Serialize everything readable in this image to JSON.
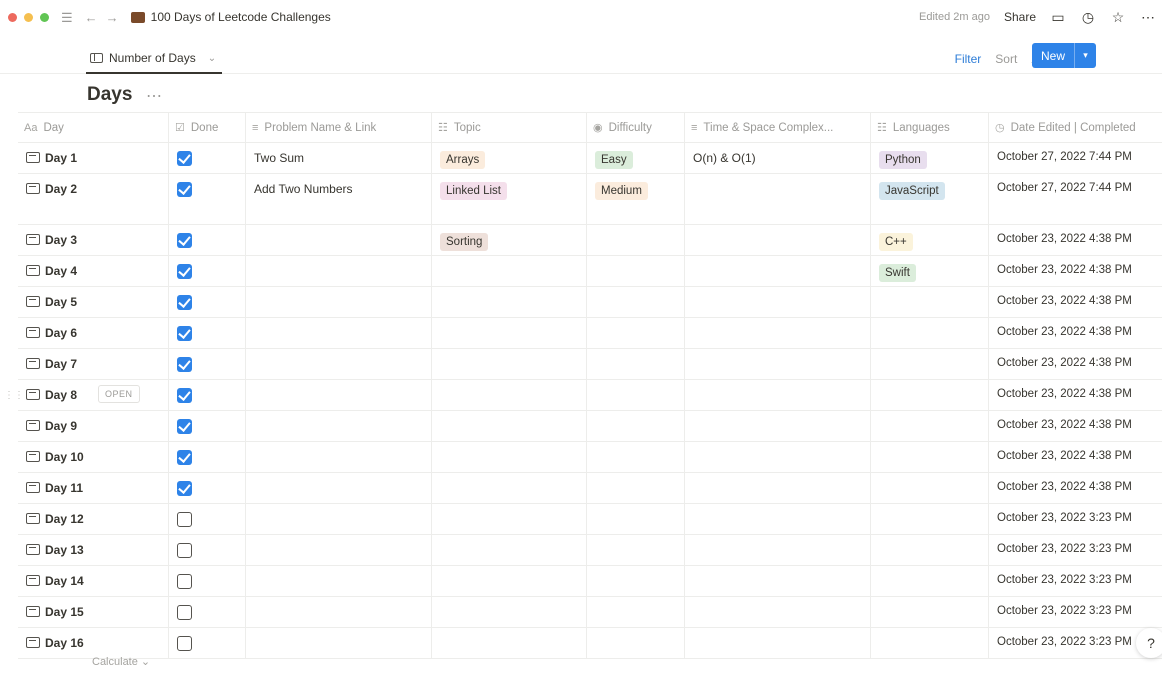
{
  "topbar": {
    "page_title": "100 Days of Leetcode Challenges",
    "edited": "Edited 2m ago",
    "share": "Share"
  },
  "view": {
    "tab_label": "Number of Days",
    "filter": "Filter",
    "sort": "Sort",
    "new_label": "New"
  },
  "database": {
    "title": "Days"
  },
  "columns": [
    {
      "label": "Day",
      "icon": "Aa"
    },
    {
      "label": "Done",
      "icon": "checkbox-icon"
    },
    {
      "label": "Problem Name & Link",
      "icon": "text-icon"
    },
    {
      "label": "Topic",
      "icon": "multi-select-icon"
    },
    {
      "label": "Difficulty",
      "icon": "select-icon"
    },
    {
      "label": "Time & Space Complex...",
      "icon": "text-icon"
    },
    {
      "label": "Languages",
      "icon": "multi-select-icon"
    },
    {
      "label": "Date Edited | Completed",
      "icon": "clock-icon"
    }
  ],
  "rows": [
    {
      "day": "Day 1",
      "done": true,
      "problem": "Two Sum",
      "topic": "Arrays",
      "topic_color": "#fbecdd",
      "difficulty": "Easy",
      "difficulty_color": "#dbeddb",
      "complexity": "O(n) & O(1)",
      "language": "Python",
      "language_color": "#e8deee",
      "date": "October 27, 2022 7:44 PM"
    },
    {
      "day": "Day 2",
      "done": true,
      "problem": "Add Two Numbers",
      "topic": "Linked List",
      "topic_color": "#f4dfeb",
      "difficulty": "Medium",
      "difficulty_color": "#fbecdd",
      "complexity": "",
      "language": "JavaScript",
      "language_color": "#d3e5ef",
      "date": "October 27, 2022 7:44 PM"
    },
    {
      "day": "Day 3",
      "done": true,
      "problem": "",
      "topic": "Sorting",
      "topic_color": "#eee0da",
      "difficulty": "",
      "difficulty_color": "",
      "complexity": "",
      "language": "C++",
      "language_color": "#fbf3db",
      "date": "October 23, 2022 4:38 PM"
    },
    {
      "day": "Day 4",
      "done": true,
      "problem": "",
      "topic": "",
      "topic_color": "",
      "difficulty": "",
      "difficulty_color": "",
      "complexity": "",
      "language": "Swift",
      "language_color": "#dbeddb",
      "date": "October 23, 2022 4:38 PM"
    },
    {
      "day": "Day 5",
      "done": true,
      "problem": "",
      "topic": "",
      "topic_color": "",
      "difficulty": "",
      "difficulty_color": "",
      "complexity": "",
      "language": "",
      "language_color": "",
      "date": "October 23, 2022 4:38 PM"
    },
    {
      "day": "Day 6",
      "done": true,
      "problem": "",
      "topic": "",
      "topic_color": "",
      "difficulty": "",
      "difficulty_color": "",
      "complexity": "",
      "language": "",
      "language_color": "",
      "date": "October 23, 2022 4:38 PM"
    },
    {
      "day": "Day 7",
      "done": true,
      "problem": "",
      "topic": "",
      "topic_color": "",
      "difficulty": "",
      "difficulty_color": "",
      "complexity": "",
      "language": "",
      "language_color": "",
      "date": "October 23, 2022 4:38 PM"
    },
    {
      "day": "Day 8",
      "done": true,
      "problem": "",
      "topic": "",
      "topic_color": "",
      "difficulty": "",
      "difficulty_color": "",
      "complexity": "",
      "language": "",
      "language_color": "",
      "date": "October 23, 2022 4:38 PM",
      "open": "OPEN"
    },
    {
      "day": "Day 9",
      "done": true,
      "problem": "",
      "topic": "",
      "topic_color": "",
      "difficulty": "",
      "difficulty_color": "",
      "complexity": "",
      "language": "",
      "language_color": "",
      "date": "October 23, 2022 4:38 PM"
    },
    {
      "day": "Day 10",
      "done": true,
      "problem": "",
      "topic": "",
      "topic_color": "",
      "difficulty": "",
      "difficulty_color": "",
      "complexity": "",
      "language": "",
      "language_color": "",
      "date": "October 23, 2022 4:38 PM"
    },
    {
      "day": "Day 11",
      "done": true,
      "problem": "",
      "topic": "",
      "topic_color": "",
      "difficulty": "",
      "difficulty_color": "",
      "complexity": "",
      "language": "",
      "language_color": "",
      "date": "October 23, 2022 4:38 PM"
    },
    {
      "day": "Day 12",
      "done": false,
      "problem": "",
      "topic": "",
      "topic_color": "",
      "difficulty": "",
      "difficulty_color": "",
      "complexity": "",
      "language": "",
      "language_color": "",
      "date": "October 23, 2022 3:23 PM"
    },
    {
      "day": "Day 13",
      "done": false,
      "problem": "",
      "topic": "",
      "topic_color": "",
      "difficulty": "",
      "difficulty_color": "",
      "complexity": "",
      "language": "",
      "language_color": "",
      "date": "October 23, 2022 3:23 PM"
    },
    {
      "day": "Day 14",
      "done": false,
      "problem": "",
      "topic": "",
      "topic_color": "",
      "difficulty": "",
      "difficulty_color": "",
      "complexity": "",
      "language": "",
      "language_color": "",
      "date": "October 23, 2022 3:23 PM"
    },
    {
      "day": "Day 15",
      "done": false,
      "problem": "",
      "topic": "",
      "topic_color": "",
      "difficulty": "",
      "difficulty_color": "",
      "complexity": "",
      "language": "",
      "language_color": "",
      "date": "October 23, 2022 3:23 PM"
    },
    {
      "day": "Day 16",
      "done": false,
      "problem": "",
      "topic": "",
      "topic_color": "",
      "difficulty": "",
      "difficulty_color": "",
      "complexity": "",
      "language": "",
      "language_color": "",
      "date": "October 23, 2022 3:23 PM"
    }
  ],
  "footer": {
    "calculate": "Calculate ⌄",
    "help": "?"
  }
}
